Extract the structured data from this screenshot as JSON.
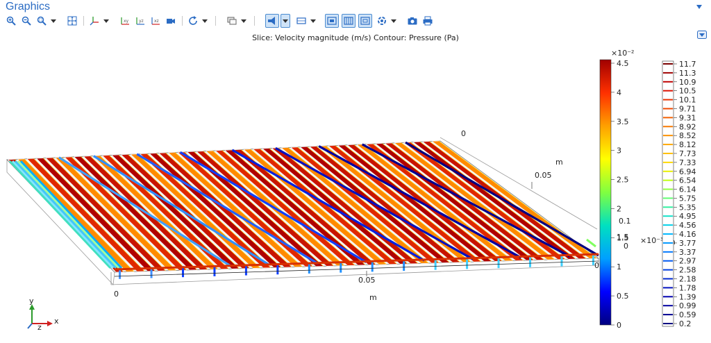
{
  "panel": {
    "title": "Graphics"
  },
  "toolbar": {
    "buttons": [
      {
        "icon": "zoom-in-icon"
      },
      {
        "icon": "zoom-out-icon"
      },
      {
        "icon": "zoom-box-icon"
      },
      {
        "icon": "zoom-extents-icon"
      },
      {
        "icon": "go-to-default-view-icon"
      },
      {
        "icon": "xy-plane-icon"
      },
      {
        "icon": "yz-plane-icon"
      },
      {
        "icon": "xz-plane-icon"
      },
      {
        "icon": "camera-view-icon"
      },
      {
        "icon": "rotate-icon"
      },
      {
        "icon": "select-domain-icon"
      },
      {
        "icon": "scene-light-icon"
      },
      {
        "icon": "transparency-icon"
      },
      {
        "icon": "wireframe-icon"
      },
      {
        "icon": "grid-icon"
      },
      {
        "icon": "render-icon"
      },
      {
        "icon": "refresh-icon"
      },
      {
        "icon": "screenshot-icon"
      },
      {
        "icon": "print-icon"
      }
    ],
    "tick_labels": {
      "xy": "xy",
      "yz": "yz",
      "xz": "xz"
    }
  },
  "plot": {
    "title": "Slice: Velocity magnitude (m/s)  Contour: Pressure (Pa)",
    "axes": {
      "x_unit": "m",
      "x_ticks": [
        "0",
        "0.05"
      ],
      "y_unit": "m",
      "y_ticks": [
        "0",
        "0.05"
      ],
      "z_unit": "m",
      "z_ticks": [
        "0",
        "1.5",
        "0.1"
      ],
      "z_scale_label": "×10⁻³",
      "triad": {
        "x": "x",
        "y": "y",
        "z": "z"
      }
    },
    "slice_legend": {
      "scale": "×10⁻²",
      "ticks": [
        "4.5",
        "4",
        "3.5",
        "3",
        "2.5",
        "2",
        "1.5",
        "1",
        "0.5",
        "0"
      ],
      "colors": [
        "#000080",
        "#0000ff",
        "#00a0ff",
        "#00e0c0",
        "#80ff40",
        "#ffff00",
        "#ffa000",
        "#ff3000",
        "#a00000"
      ]
    },
    "contour_legend": {
      "values": [
        "11.7",
        "11.3",
        "10.9",
        "10.5",
        "10.1",
        "9.71",
        "9.31",
        "8.92",
        "8.52",
        "8.12",
        "7.73",
        "7.33",
        "6.94",
        "6.54",
        "6.14",
        "5.75",
        "5.35",
        "4.95",
        "4.56",
        "4.16",
        "3.77",
        "3.37",
        "2.97",
        "2.58",
        "2.18",
        "1.78",
        "1.39",
        "0.99",
        "0.59",
        "0.2"
      ],
      "colors": [
        "#7a0000",
        "#a00000",
        "#c00000",
        "#dc1000",
        "#e83000",
        "#f04800",
        "#f46000",
        "#f87800",
        "#fc9000",
        "#ffa800",
        "#ffc000",
        "#ffd800",
        "#e8f000",
        "#c0ff10",
        "#90ff40",
        "#60ff70",
        "#30f0a0",
        "#10e0c8",
        "#00d0e8",
        "#00b8ff",
        "#0098ff",
        "#0078ff",
        "#0058f0",
        "#0040e0",
        "#0028d0",
        "#0010c0",
        "#0000b0",
        "#0000a0",
        "#000090",
        "#000080"
      ]
    }
  }
}
